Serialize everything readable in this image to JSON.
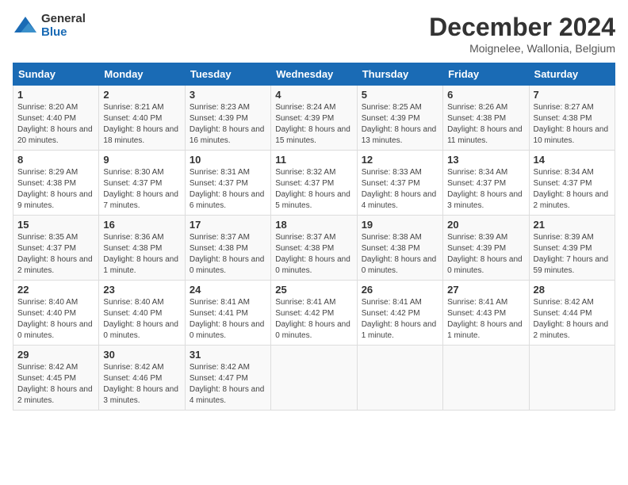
{
  "logo": {
    "general": "General",
    "blue": "Blue"
  },
  "title": "December 2024",
  "subtitle": "Moignelee, Wallonia, Belgium",
  "days_of_week": [
    "Sunday",
    "Monday",
    "Tuesday",
    "Wednesday",
    "Thursday",
    "Friday",
    "Saturday"
  ],
  "weeks": [
    [
      {
        "day": "1",
        "sunrise": "Sunrise: 8:20 AM",
        "sunset": "Sunset: 4:40 PM",
        "daylight": "Daylight: 8 hours and 20 minutes."
      },
      {
        "day": "2",
        "sunrise": "Sunrise: 8:21 AM",
        "sunset": "Sunset: 4:40 PM",
        "daylight": "Daylight: 8 hours and 18 minutes."
      },
      {
        "day": "3",
        "sunrise": "Sunrise: 8:23 AM",
        "sunset": "Sunset: 4:39 PM",
        "daylight": "Daylight: 8 hours and 16 minutes."
      },
      {
        "day": "4",
        "sunrise": "Sunrise: 8:24 AM",
        "sunset": "Sunset: 4:39 PM",
        "daylight": "Daylight: 8 hours and 15 minutes."
      },
      {
        "day": "5",
        "sunrise": "Sunrise: 8:25 AM",
        "sunset": "Sunset: 4:39 PM",
        "daylight": "Daylight: 8 hours and 13 minutes."
      },
      {
        "day": "6",
        "sunrise": "Sunrise: 8:26 AM",
        "sunset": "Sunset: 4:38 PM",
        "daylight": "Daylight: 8 hours and 11 minutes."
      },
      {
        "day": "7",
        "sunrise": "Sunrise: 8:27 AM",
        "sunset": "Sunset: 4:38 PM",
        "daylight": "Daylight: 8 hours and 10 minutes."
      }
    ],
    [
      {
        "day": "8",
        "sunrise": "Sunrise: 8:29 AM",
        "sunset": "Sunset: 4:38 PM",
        "daylight": "Daylight: 8 hours and 9 minutes."
      },
      {
        "day": "9",
        "sunrise": "Sunrise: 8:30 AM",
        "sunset": "Sunset: 4:37 PM",
        "daylight": "Daylight: 8 hours and 7 minutes."
      },
      {
        "day": "10",
        "sunrise": "Sunrise: 8:31 AM",
        "sunset": "Sunset: 4:37 PM",
        "daylight": "Daylight: 8 hours and 6 minutes."
      },
      {
        "day": "11",
        "sunrise": "Sunrise: 8:32 AM",
        "sunset": "Sunset: 4:37 PM",
        "daylight": "Daylight: 8 hours and 5 minutes."
      },
      {
        "day": "12",
        "sunrise": "Sunrise: 8:33 AM",
        "sunset": "Sunset: 4:37 PM",
        "daylight": "Daylight: 8 hours and 4 minutes."
      },
      {
        "day": "13",
        "sunrise": "Sunrise: 8:34 AM",
        "sunset": "Sunset: 4:37 PM",
        "daylight": "Daylight: 8 hours and 3 minutes."
      },
      {
        "day": "14",
        "sunrise": "Sunrise: 8:34 AM",
        "sunset": "Sunset: 4:37 PM",
        "daylight": "Daylight: 8 hours and 2 minutes."
      }
    ],
    [
      {
        "day": "15",
        "sunrise": "Sunrise: 8:35 AM",
        "sunset": "Sunset: 4:37 PM",
        "daylight": "Daylight: 8 hours and 2 minutes."
      },
      {
        "day": "16",
        "sunrise": "Sunrise: 8:36 AM",
        "sunset": "Sunset: 4:38 PM",
        "daylight": "Daylight: 8 hours and 1 minute."
      },
      {
        "day": "17",
        "sunrise": "Sunrise: 8:37 AM",
        "sunset": "Sunset: 4:38 PM",
        "daylight": "Daylight: 8 hours and 0 minutes."
      },
      {
        "day": "18",
        "sunrise": "Sunrise: 8:37 AM",
        "sunset": "Sunset: 4:38 PM",
        "daylight": "Daylight: 8 hours and 0 minutes."
      },
      {
        "day": "19",
        "sunrise": "Sunrise: 8:38 AM",
        "sunset": "Sunset: 4:38 PM",
        "daylight": "Daylight: 8 hours and 0 minutes."
      },
      {
        "day": "20",
        "sunrise": "Sunrise: 8:39 AM",
        "sunset": "Sunset: 4:39 PM",
        "daylight": "Daylight: 8 hours and 0 minutes."
      },
      {
        "day": "21",
        "sunrise": "Sunrise: 8:39 AM",
        "sunset": "Sunset: 4:39 PM",
        "daylight": "Daylight: 7 hours and 59 minutes."
      }
    ],
    [
      {
        "day": "22",
        "sunrise": "Sunrise: 8:40 AM",
        "sunset": "Sunset: 4:40 PM",
        "daylight": "Daylight: 8 hours and 0 minutes."
      },
      {
        "day": "23",
        "sunrise": "Sunrise: 8:40 AM",
        "sunset": "Sunset: 4:40 PM",
        "daylight": "Daylight: 8 hours and 0 minutes."
      },
      {
        "day": "24",
        "sunrise": "Sunrise: 8:41 AM",
        "sunset": "Sunset: 4:41 PM",
        "daylight": "Daylight: 8 hours and 0 minutes."
      },
      {
        "day": "25",
        "sunrise": "Sunrise: 8:41 AM",
        "sunset": "Sunset: 4:42 PM",
        "daylight": "Daylight: 8 hours and 0 minutes."
      },
      {
        "day": "26",
        "sunrise": "Sunrise: 8:41 AM",
        "sunset": "Sunset: 4:42 PM",
        "daylight": "Daylight: 8 hours and 1 minute."
      },
      {
        "day": "27",
        "sunrise": "Sunrise: 8:41 AM",
        "sunset": "Sunset: 4:43 PM",
        "daylight": "Daylight: 8 hours and 1 minute."
      },
      {
        "day": "28",
        "sunrise": "Sunrise: 8:42 AM",
        "sunset": "Sunset: 4:44 PM",
        "daylight": "Daylight: 8 hours and 2 minutes."
      }
    ],
    [
      {
        "day": "29",
        "sunrise": "Sunrise: 8:42 AM",
        "sunset": "Sunset: 4:45 PM",
        "daylight": "Daylight: 8 hours and 2 minutes."
      },
      {
        "day": "30",
        "sunrise": "Sunrise: 8:42 AM",
        "sunset": "Sunset: 4:46 PM",
        "daylight": "Daylight: 8 hours and 3 minutes."
      },
      {
        "day": "31",
        "sunrise": "Sunrise: 8:42 AM",
        "sunset": "Sunset: 4:47 PM",
        "daylight": "Daylight: 8 hours and 4 minutes."
      },
      null,
      null,
      null,
      null
    ]
  ]
}
